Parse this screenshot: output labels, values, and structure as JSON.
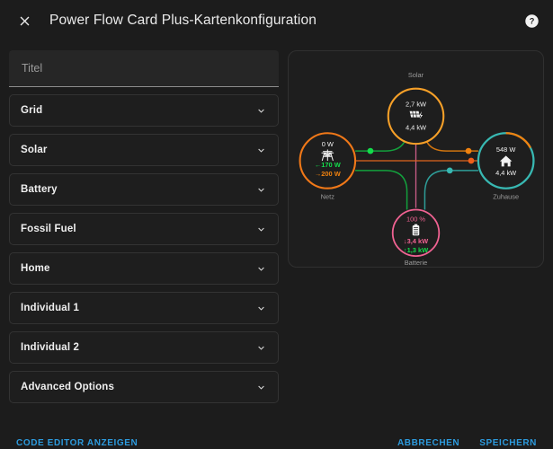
{
  "header": {
    "title": "Power Flow Card Plus-Kartenkonfiguration",
    "close_icon": "close-icon",
    "help_icon": "help-circle-icon"
  },
  "form": {
    "title_input": {
      "value": "",
      "placeholder": "Titel"
    },
    "sections": [
      {
        "label": "Grid"
      },
      {
        "label": "Solar"
      },
      {
        "label": "Battery"
      },
      {
        "label": "Fossil Fuel"
      },
      {
        "label": "Home"
      },
      {
        "label": "Individual 1"
      },
      {
        "label": "Individual 2"
      },
      {
        "label": "Advanced Options"
      }
    ]
  },
  "preview": {
    "nodes": {
      "solar": {
        "label": "Solar",
        "top_value": "2,7 kW",
        "bottom_value": "4,4 kW",
        "icon": "solar-panel-icon",
        "color": "#f7a028"
      },
      "grid": {
        "label": "Netz",
        "top_value": "0 W",
        "import_value": "←170 W",
        "export_value": "→200 W",
        "icon": "transmission-tower-icon",
        "color": "#f07818",
        "import_color": "#13dc4b",
        "export_color": "#f0820f"
      },
      "home": {
        "label": "Zuhause",
        "top_value": "548 W",
        "bottom_value": "4,4 kW",
        "icon": "home-icon",
        "color": "#38b8b2"
      },
      "battery": {
        "label": "Batterie",
        "percent": "100 %",
        "charge_value": "↓3,4 kW",
        "discharge_value": "↑1,3 kW",
        "icon": "battery-icon",
        "color": "#f06292",
        "discharge_color": "#13dc4b"
      }
    },
    "flows": [
      {
        "name": "grid-to-solar",
        "color": "#13a13d"
      },
      {
        "name": "solar-to-home",
        "color": "#d1750f"
      },
      {
        "name": "grid-to-home",
        "color": "#e0651d"
      },
      {
        "name": "grid-to-battery",
        "color": "#13a13d"
      },
      {
        "name": "battery-to-home",
        "color": "#2e9e99"
      },
      {
        "name": "solar-to-battery",
        "color": "#cf5f8a"
      }
    ]
  },
  "footer": {
    "code_editor": "CODE EDITOR ANZEIGEN",
    "cancel": "ABBRECHEN",
    "save": "SPEICHERN"
  },
  "colors": {
    "accent_link": "#2d9bde",
    "background": "#1c1c1c",
    "surface": "#1e1e1e"
  }
}
